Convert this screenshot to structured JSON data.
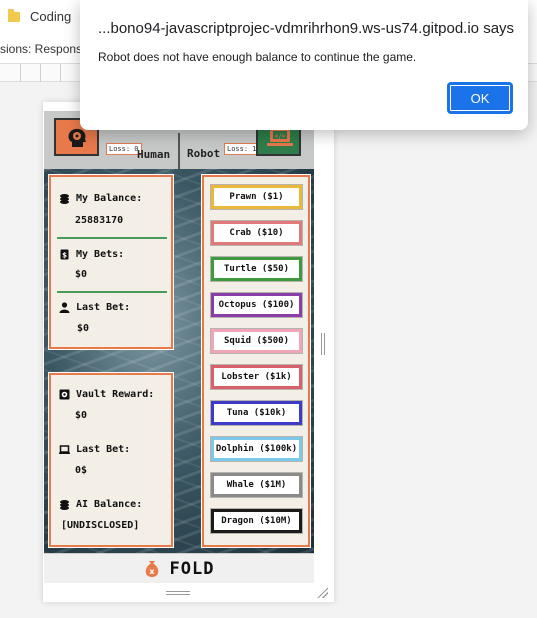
{
  "browser": {
    "tab_title": "Coding",
    "devtools_label": "sions: Responsi"
  },
  "dialog": {
    "title": "...bono94-javascriptprojec-vdmrihrhon9.ws-us74.gitpod.io says",
    "message": "Robot does not have enough balance to continue the game.",
    "ok_label": "OK",
    "button_color": "#1a73e8"
  },
  "players": {
    "human": {
      "name": "Human",
      "loss_label": "Loss: 0",
      "icon": "brain-head-icon",
      "color": "#e8794b"
    },
    "robot": {
      "name": "Robot",
      "loss_label": "Loss: 1",
      "icon": "code-laptop-icon",
      "color": "#2e7d4a"
    }
  },
  "stats": {
    "balance_label": "My Balance:",
    "balance_value": "25883170",
    "bets_label": "My Bets:",
    "bets_value": "$0",
    "last_bet_label": "Last Bet:",
    "last_bet_value": "$0"
  },
  "vault": {
    "reward_label": "Vault Reward:",
    "reward_value": "$0",
    "last_bet_label": "Last Bet:",
    "last_bet_value": "0$",
    "ai_balance_label": "AI Balance:",
    "ai_balance_value": "[UNDISCLOSED]"
  },
  "bets": [
    {
      "label": "Prawn ($1)",
      "color": "#e8b93a"
    },
    {
      "label": "Crab ($10)",
      "color": "#e07a7a"
    },
    {
      "label": "Turtle ($50)",
      "color": "#3f9a3f"
    },
    {
      "label": "Octopus ($100)",
      "color": "#8a3fa8"
    },
    {
      "label": "Squid ($500)",
      "color": "#f0a6b8"
    },
    {
      "label": "Lobster ($1k)",
      "color": "#d8606a"
    },
    {
      "label": "Tuna ($10k)",
      "color": "#3c3cc8"
    },
    {
      "label": "Dolphin ($100k)",
      "color": "#7cc8e8"
    },
    {
      "label": "Whale ($1M)",
      "color": "#8a8a8a"
    },
    {
      "label": "Dragon ($10M)",
      "color": "#1a1a1a"
    }
  ],
  "fold": {
    "label": "FOLD",
    "icon": "money-bag-icon"
  },
  "accent_color": "#e8794b"
}
